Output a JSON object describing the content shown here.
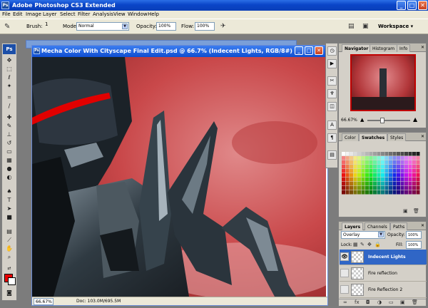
{
  "app": {
    "title": "Adobe Photoshop CS3 Extended",
    "icon_label": "Ps",
    "window_buttons": {
      "minimize": "_",
      "maximize": "□",
      "close": "✕"
    }
  },
  "menu": [
    "File",
    "Edit",
    "Image",
    "Layer",
    "Select",
    "Filter",
    "Analysis",
    "View",
    "Window",
    "Help"
  ],
  "options": {
    "brush_label": "Brush:",
    "brush_size": "1",
    "mode_label": "Mode:",
    "mode_value": "Normal",
    "opacity_label": "Opacity:",
    "opacity_value": "100%",
    "flow_label": "Flow:",
    "flow_value": "100%",
    "workspace_label": "Workspace ▾"
  },
  "toolbox": {
    "logo": "Ps",
    "tools": [
      "move-tool-icon",
      "marquee-tool-icon",
      "lasso-tool-icon",
      "magic-wand-icon",
      "crop-tool-icon",
      "slice-tool-icon",
      "healing-brush-icon",
      "brush-tool-icon",
      "clone-stamp-icon",
      "history-brush-icon",
      "eraser-tool-icon",
      "gradient-tool-icon",
      "blur-tool-icon",
      "dodge-tool-icon",
      "pen-tool-icon",
      "type-tool-icon",
      "path-select-icon",
      "shape-tool-icon",
      "notes-tool-icon",
      "eyedropper-icon",
      "hand-tool-icon",
      "zoom-tool-icon"
    ],
    "foreground_color": "#e80000",
    "background_color": "#ffffff"
  },
  "document": {
    "title": "Mecha Color With Cityscape Final Edit.psd @ 66.7% (Indecent Lights, RGB/8#)",
    "zoom": "66.67%",
    "doc_info": "Doc: 103.0M/695.5M"
  },
  "navigator": {
    "tabs": [
      "Navigator",
      "Histogram",
      "Info"
    ],
    "zoom": "66.67%"
  },
  "color_panel": {
    "tabs": [
      "Color",
      "Swatches",
      "Styles"
    ]
  },
  "layers": {
    "tabs": [
      "Layers",
      "Channels",
      "Paths"
    ],
    "blend_mode": "Overlay",
    "opacity_label": "Opacity:",
    "opacity_value": "100%",
    "lock_label": "Lock:",
    "fill_label": "Fill:",
    "fill_value": "100%",
    "items": [
      {
        "name": "Indecent Lights",
        "selected": true,
        "visible": true
      },
      {
        "name": "Fire reflection",
        "selected": false,
        "visible": false
      },
      {
        "name": "Fire Reflection 2",
        "selected": false,
        "visible": false
      }
    ]
  },
  "colors": {
    "accent_blue": "#0a45c8",
    "selected_layer": "#3066c6",
    "canvas_red": "#c9484a"
  }
}
